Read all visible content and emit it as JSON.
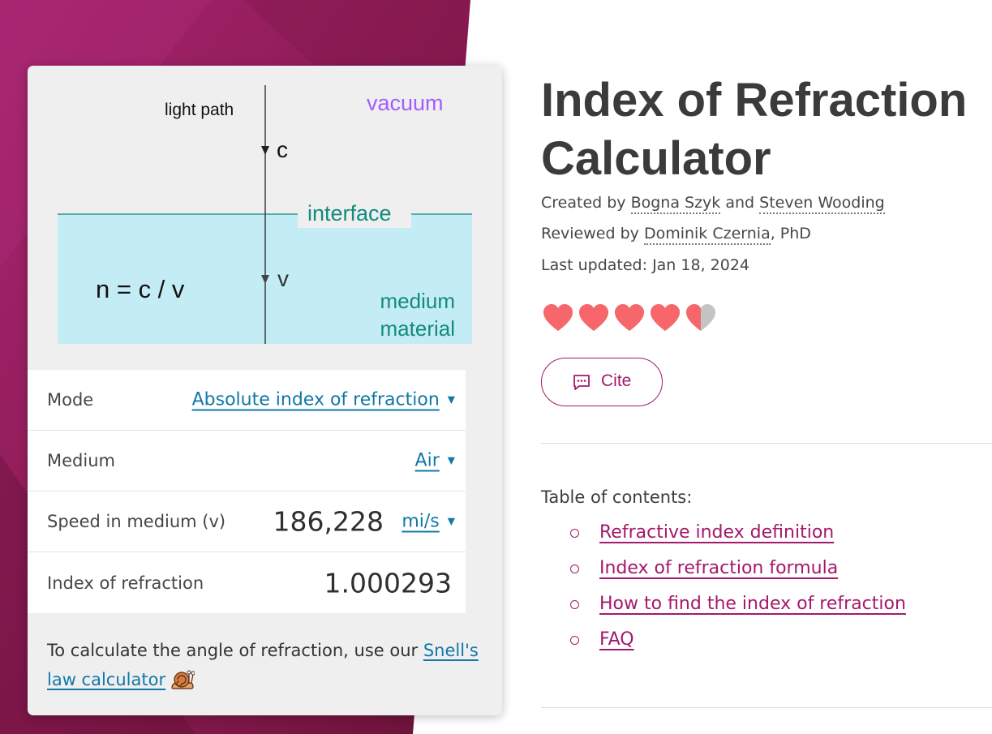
{
  "diagram": {
    "light_path_label": "light path",
    "vacuum_label": "vacuum",
    "c_label": "c",
    "interface_label": "interface",
    "formula": "n = c / v",
    "v_label": "v",
    "medium_line1": "medium",
    "medium_line2": "material",
    "colors": {
      "vacuum": "#a45cff",
      "interface": "#138a80",
      "medium_fill": "#c4ecf5"
    }
  },
  "calculator": {
    "rows": [
      {
        "label": "Mode",
        "select_value": "Absolute index of refraction"
      },
      {
        "label": "Medium",
        "select_value": "Air"
      },
      {
        "label": "Speed in medium (v)",
        "value": "186,228",
        "unit": "mi/s"
      },
      {
        "label": "Index of refraction",
        "value": "1.000293"
      }
    ],
    "note_text": "To calculate the angle of refraction, use our ",
    "note_link": "Snell's law calculator"
  },
  "article": {
    "title": "Index of Refraction Calculator",
    "created_prefix": "Created by ",
    "author1": "Bogna Szyk",
    "and_text": " and ",
    "author2": "Steven Wooding",
    "reviewed_prefix": "Reviewed by ",
    "reviewer": "Dominik Czernia",
    "reviewer_suffix": ", PhD",
    "last_updated": "Last updated: Jan 18, 2024",
    "rating": 4.5,
    "rating_max": 5,
    "cite_label": "Cite",
    "toc_title": "Table of contents:",
    "toc_items": [
      "Refractive index definition",
      "Index of refraction formula",
      "How to find the index of refraction",
      "FAQ"
    ]
  },
  "colors": {
    "brand_magenta": "#a4196b",
    "link_blue": "#1178a8",
    "heart": "#f7666b",
    "heart_empty": "#c4c4c4",
    "background_gradient": [
      "#a12370",
      "#6e1440"
    ]
  }
}
